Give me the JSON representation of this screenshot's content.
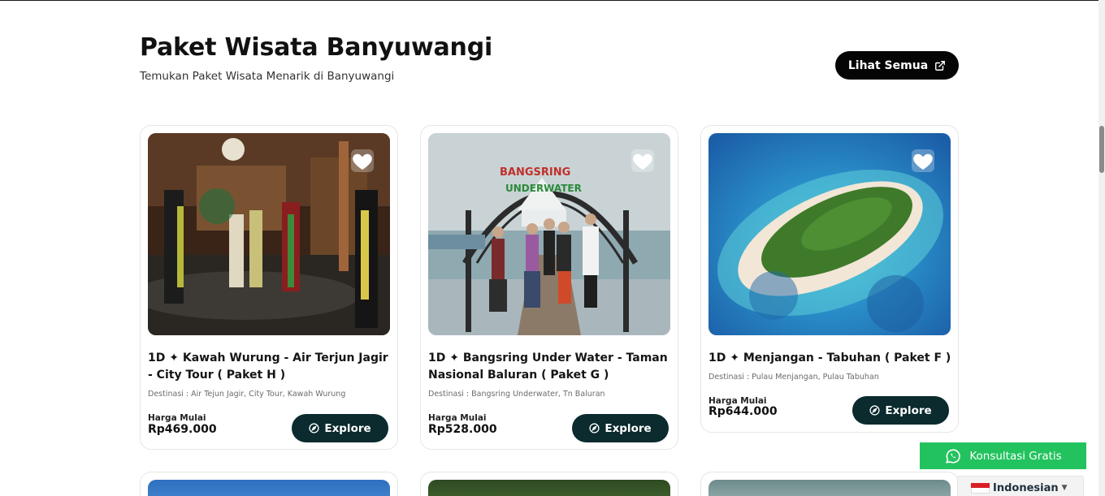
{
  "section": {
    "title": "Paket Wisata Banyuwangi",
    "subtitle": "Temukan Paket Wisata Menarik di Banyuwangi",
    "view_all_label": "Lihat Semua"
  },
  "packages": [
    {
      "name": "1D ✦ Kawah Wurung - Air Terjun Jagir - City Tour ( Paket H )",
      "destination": "Destinasi : Air Tejun Jagir, City Tour, Kawah Wurung",
      "price_label": "Harga Mulai",
      "price": "Rp469.000",
      "explore_label": "Explore"
    },
    {
      "name": "1D ✦ Bangsring Under Water - Taman Nasional Baluran ( Paket G )",
      "destination": "Destinasi : Bangsring Underwater, Tn Baluran",
      "price_label": "Harga Mulai",
      "price": "Rp528.000",
      "explore_label": "Explore",
      "image_sign_text": "BANGSRING UNDERWATER"
    },
    {
      "name": "1D ✦ Menjangan - Tabuhan ( Paket F )",
      "destination": "Destinasi : Pulau Menjangan, Pulau Tabuhan",
      "price_label": "Harga Mulai",
      "price": "Rp644.000",
      "explore_label": "Explore"
    }
  ],
  "whatsapp": {
    "label": "Konsultasi Gratis"
  },
  "language": {
    "selected": "Indonesian"
  },
  "colors": {
    "primary_dark": "#0b2b2e",
    "button_black": "#050505",
    "whatsapp_green": "#22c35e"
  }
}
